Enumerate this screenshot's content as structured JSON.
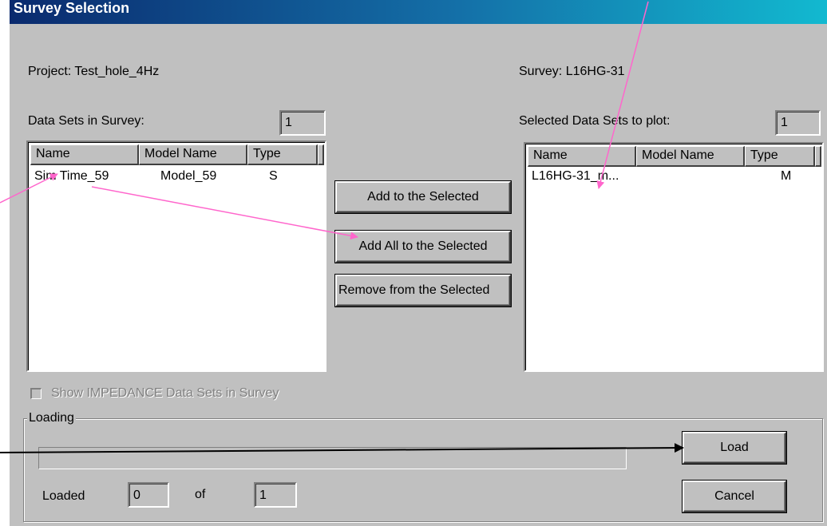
{
  "window": {
    "title": "Survey Selection"
  },
  "project": {
    "label": "Project: Test_hole_4Hz"
  },
  "survey": {
    "label": "Survey: L16HG-31"
  },
  "left_list": {
    "heading": "Data Sets in Survey:",
    "count": "1",
    "columns": [
      "Name",
      "Model Name",
      "Type"
    ],
    "rows": [
      {
        "name": "Sim Time_59",
        "model": "Model_59",
        "type": "S"
      }
    ]
  },
  "right_list": {
    "heading": "Selected Data Sets to plot:",
    "count": "1",
    "columns": [
      "Name",
      "Model Name",
      "Type"
    ],
    "rows": [
      {
        "name": "L16HG-31_m...",
        "model": "",
        "type": "M"
      }
    ]
  },
  "buttons": {
    "add": "Add to the Selected",
    "add_all": "Add All to the Selected",
    "remove": "Remove from the Selected",
    "load": "Load",
    "cancel": "Cancel"
  },
  "impedance": {
    "label": "Show IMPEDANCE Data Sets in Survey",
    "checked": false,
    "enabled": false
  },
  "loading": {
    "group_label": "Loading",
    "progress": 0,
    "loaded_label": "Loaded",
    "loaded_value": "0",
    "of_label": "of",
    "total_value": "1"
  },
  "annotation_colors": {
    "pink_arrow": "#ff66cc",
    "black_arrow": "#000000"
  }
}
